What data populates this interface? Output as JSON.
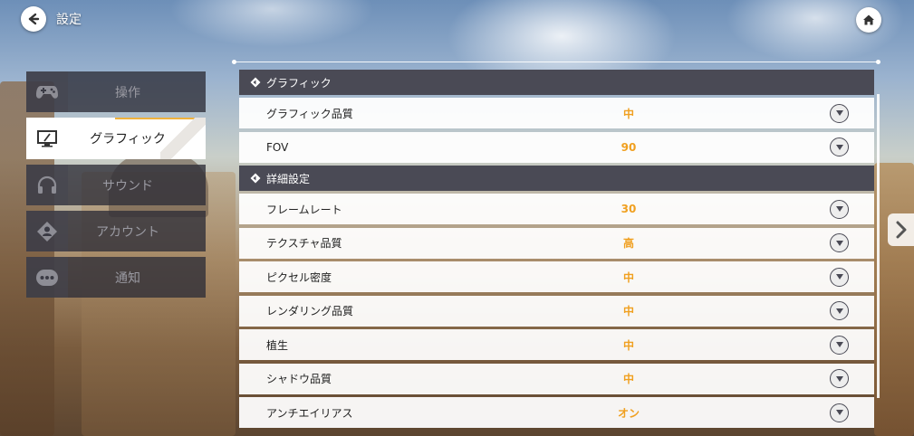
{
  "header": {
    "title": "設定"
  },
  "sidebar": {
    "items": [
      {
        "label": "操作",
        "icon": "gamepad-icon",
        "active": false
      },
      {
        "label": "グラフィック",
        "icon": "monitor-icon",
        "active": true
      },
      {
        "label": "サウンド",
        "icon": "headphones-icon",
        "active": false
      },
      {
        "label": "アカウント",
        "icon": "user-icon",
        "active": false
      },
      {
        "label": "通知",
        "icon": "dots-icon",
        "active": false
      }
    ]
  },
  "sections": [
    {
      "title": "グラフィック",
      "rows": [
        {
          "label": "グラフィック品質",
          "value": "中"
        },
        {
          "label": "FOV",
          "value": "90"
        }
      ]
    },
    {
      "title": "詳細設定",
      "rows": [
        {
          "label": "フレームレート",
          "value": "30"
        },
        {
          "label": "テクスチャ品質",
          "value": "高"
        },
        {
          "label": "ピクセル密度",
          "value": "中"
        },
        {
          "label": "レンダリング品質",
          "value": "中"
        },
        {
          "label": "植生",
          "value": "中"
        },
        {
          "label": "シャドウ品質",
          "value": "中"
        },
        {
          "label": "アンチエイリアス",
          "value": "オン"
        }
      ]
    }
  ],
  "colors": {
    "accent": "#f0a020",
    "header_bg": "#4a4a55"
  }
}
